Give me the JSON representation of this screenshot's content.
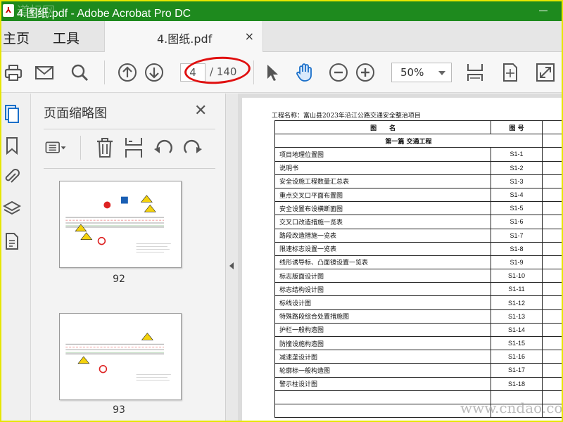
{
  "window": {
    "title": "4.图纸.pdf - Adobe Acrobat Pro DC",
    "watermark": "道标网"
  },
  "tabs": {
    "home": "主页",
    "tools": "工具",
    "document": "4.图纸.pdf",
    "close_glyph": "×"
  },
  "toolbar": {
    "page_current": "4",
    "page_total": "/ 140",
    "zoom": "50%",
    "icons": [
      "print-icon",
      "email-icon",
      "search-icon",
      "page-up-icon",
      "page-down-icon",
      "select-pointer-icon",
      "hand-tool-icon",
      "zoom-out-icon",
      "zoom-in-icon",
      "fit-width-icon",
      "fit-page-icon",
      "fullscreen-icon"
    ],
    "accent_color": "#1a6fc9"
  },
  "rail": {
    "icons": [
      "page-thumbnails-icon",
      "bookmark-icon",
      "attachment-icon",
      "layers-icon",
      "document-properties-icon"
    ]
  },
  "panel": {
    "title": "页面缩略图",
    "close_glyph": "✕",
    "thumbnails": [
      {
        "label": "92"
      },
      {
        "label": "93"
      }
    ]
  },
  "document": {
    "project_name": "工程名称：富山县2023年沿江公路交通安全整治项目",
    "headers": {
      "name": "图　　名",
      "code": "图 号"
    },
    "section": "第一篇 交通工程",
    "rows": [
      {
        "name": "项目地理位置图",
        "code": "S1-1"
      },
      {
        "name": "说明书",
        "code": "S1-2"
      },
      {
        "name": "安全设施工程数量汇总表",
        "code": "S1-3"
      },
      {
        "name": "重点交叉口平面布置图",
        "code": "S1-4"
      },
      {
        "name": "安全设置布设横断面图",
        "code": "S1-5"
      },
      {
        "name": "交叉口改造措施一览表",
        "code": "S1-6"
      },
      {
        "name": "路段改造措施一览表",
        "code": "S1-7"
      },
      {
        "name": "限速标志设置一览表",
        "code": "S1-8"
      },
      {
        "name": "线形诱导标、凸面镜设置一览表",
        "code": "S1-9"
      },
      {
        "name": "标志版面设计图",
        "code": "S1-10"
      },
      {
        "name": "标志结构设计图",
        "code": "S1-11"
      },
      {
        "name": "标线设计图",
        "code": "S1-12"
      },
      {
        "name": "特殊路段综合处置措施图",
        "code": "S1-13"
      },
      {
        "name": "护栏一般构造图",
        "code": "S1-14"
      },
      {
        "name": "防撞设施构造图",
        "code": "S1-15"
      },
      {
        "name": "减速垄设计图",
        "code": "S1-16"
      },
      {
        "name": "轮廓标一般构造图",
        "code": "S1-17"
      },
      {
        "name": "警示柱设计图",
        "code": "S1-18"
      },
      {
        "name": "",
        "code": ""
      },
      {
        "name": "",
        "code": ""
      }
    ],
    "watermark": "www.cndao.com"
  }
}
